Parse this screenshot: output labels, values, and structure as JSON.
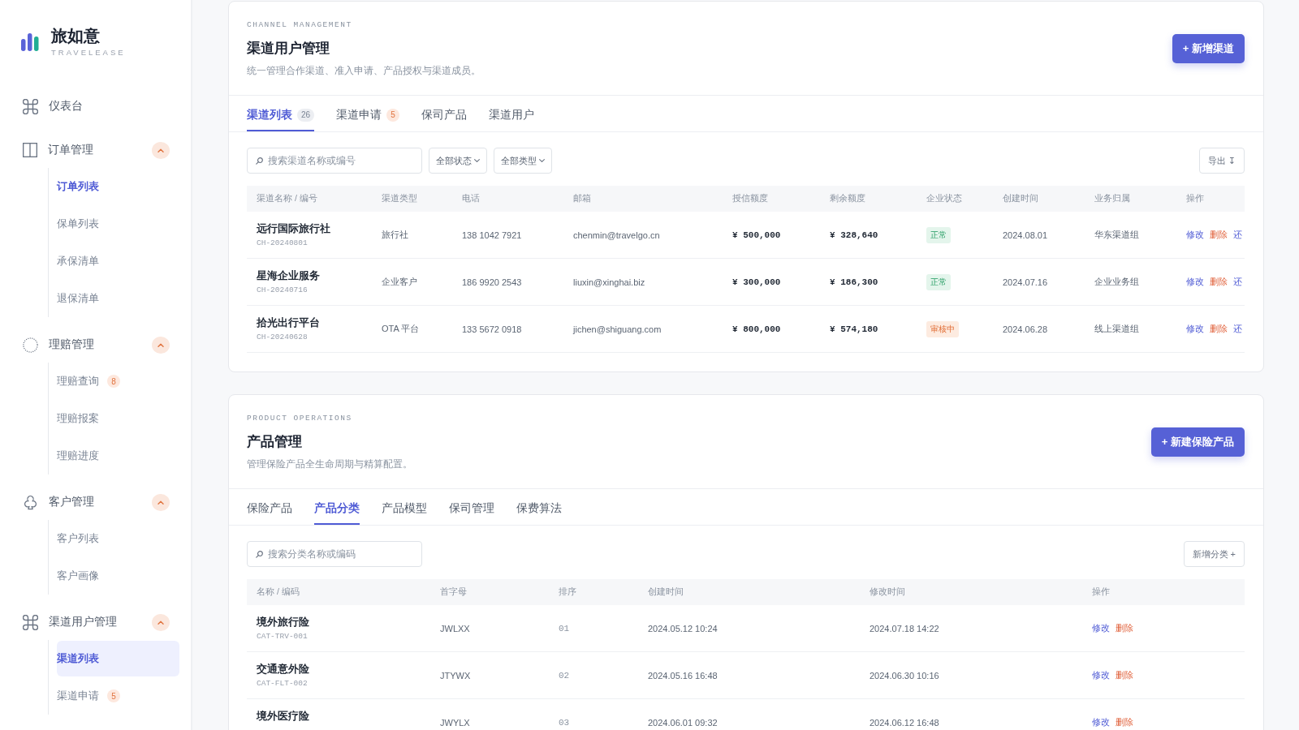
{
  "sidebar": {
    "logo": {
      "title": "旅如意",
      "subtitle": "TRAVELEASE"
    },
    "nav": [
      {
        "kind": "item",
        "label": "仪表台"
      },
      {
        "kind": "group",
        "label": "订单管理",
        "expanded": true,
        "children": [
          {
            "label": "订单列表",
            "selected": false,
            "emphasized": true
          },
          {
            "label": "保单列表",
            "selected": false,
            "emphasized": false
          },
          {
            "label": "承保清单",
            "selected": false,
            "emphasized": false
          },
          {
            "label": "退保清单",
            "selected": false,
            "emphasized": false
          }
        ]
      },
      {
        "kind": "group",
        "label": "理赔管理",
        "expanded": true,
        "children": [
          {
            "label": "理赔查询",
            "selected": false,
            "emphasized": false,
            "badge": {
              "text": "8",
              "kind": "alert"
            }
          },
          {
            "label": "理赔报案",
            "selected": false,
            "emphasized": false
          },
          {
            "label": "理赔进度",
            "selected": false,
            "emphasized": false
          }
        ]
      },
      {
        "kind": "group",
        "label": "客户管理",
        "expanded": true,
        "children": [
          {
            "label": "客户列表",
            "selected": false,
            "emphasized": false
          },
          {
            "label": "客户画像",
            "selected": false,
            "emphasized": false
          }
        ]
      },
      {
        "kind": "group",
        "label": "渠道用户管理",
        "expanded": true,
        "children": [
          {
            "label": "渠道列表",
            "selected": true,
            "emphasized": true
          },
          {
            "label": "渠道申请",
            "selected": false,
            "emphasized": false,
            "badge": {
              "text": "5",
              "kind": "alert"
            }
          }
        ]
      }
    ]
  },
  "sections": [
    {
      "eyebrow": "CHANNEL MANAGEMENT",
      "title": "渠道用户管理",
      "description": "统一管理合作渠道、准入申请、产品授权与渠道成员。",
      "primary_button": "+ 新增渠道",
      "tabs": [
        {
          "label": "渠道列表",
          "selected": true,
          "badge": {
            "text": "26",
            "kind": "neutral"
          }
        },
        {
          "label": "渠道申请",
          "selected": false,
          "badge": {
            "text": "5",
            "kind": "alert"
          }
        },
        {
          "label": "保司产品",
          "selected": false
        },
        {
          "label": "渠道用户",
          "selected": false
        }
      ],
      "search": {
        "placeholder": "搜索渠道名称或编号"
      },
      "filters": [
        "全部状态",
        "全部类型"
      ],
      "secondary_button": "导出 ↧",
      "table": {
        "columns": [
          "渠道名称 / 编号",
          "渠道类型",
          "电话",
          "邮箱",
          "授信额度",
          "剩余额度",
          "企业状态",
          "创建时间",
          "业务归属",
          "操作"
        ],
        "rows": [
          [
            {
              "kind": "title",
              "text": "远行国际旅行社",
              "code": "CH-20240801"
            },
            {
              "kind": "text",
              "text": "旅行社"
            },
            {
              "kind": "text",
              "text": "138 1042 7921"
            },
            {
              "kind": "text",
              "text": "chenmin@travelgo.cn"
            },
            {
              "kind": "amount",
              "text": "¥ 500,000"
            },
            {
              "kind": "amount",
              "text": "¥ 328,640"
            },
            {
              "kind": "status",
              "tag": {
                "text": "正常",
                "kind": "ok"
              }
            },
            {
              "kind": "text",
              "text": "2024.08.01"
            },
            {
              "kind": "text",
              "text": "华东渠道组"
            },
            {
              "kind": "actions",
              "actions": [
                {
                  "label": "修改",
                  "kind": "edit"
                },
                {
                  "label": "删除",
                  "kind": "delete"
                },
                {
                  "label": "还",
                  "kind": "more"
                }
              ]
            }
          ],
          [
            {
              "kind": "title",
              "text": "星海企业服务",
              "code": "CH-20240716"
            },
            {
              "kind": "text",
              "text": "企业客户"
            },
            {
              "kind": "text",
              "text": "186 9920 2543"
            },
            {
              "kind": "text",
              "text": "liuxin@xinghai.biz"
            },
            {
              "kind": "amount",
              "text": "¥ 300,000"
            },
            {
              "kind": "amount",
              "text": "¥ 186,300"
            },
            {
              "kind": "status",
              "tag": {
                "text": "正常",
                "kind": "ok"
              }
            },
            {
              "kind": "text",
              "text": "2024.07.16"
            },
            {
              "kind": "text",
              "text": "企业业务组"
            },
            {
              "kind": "actions",
              "actions": [
                {
                  "label": "修改",
                  "kind": "edit"
                },
                {
                  "label": "删除",
                  "kind": "delete"
                },
                {
                  "label": "还",
                  "kind": "more"
                }
              ]
            }
          ],
          [
            {
              "kind": "title",
              "text": "拾光出行平台",
              "code": "CH-20240628"
            },
            {
              "kind": "text",
              "text": "OTA 平台"
            },
            {
              "kind": "text",
              "text": "133 5672 0918"
            },
            {
              "kind": "text",
              "text": "jichen@shiguang.com"
            },
            {
              "kind": "amount",
              "text": "¥ 800,000"
            },
            {
              "kind": "amount",
              "text": "¥ 574,180"
            },
            {
              "kind": "status",
              "tag": {
                "text": "审核中",
                "kind": "pending"
              }
            },
            {
              "kind": "text",
              "text": "2024.06.28"
            },
            {
              "kind": "text",
              "text": "线上渠道组"
            },
            {
              "kind": "actions",
              "actions": [
                {
                  "label": "修改",
                  "kind": "edit"
                },
                {
                  "label": "删除",
                  "kind": "delete"
                },
                {
                  "label": "还",
                  "kind": "more"
                }
              ]
            }
          ]
        ]
      }
    },
    {
      "eyebrow": "PRODUCT OPERATIONS",
      "title": "产品管理",
      "description": "管理保险产品全生命周期与精算配置。",
      "primary_button": "+ 新建保险产品",
      "tabs": [
        {
          "label": "保险产品",
          "selected": false
        },
        {
          "label": "产品分类",
          "selected": true
        },
        {
          "label": "产品模型",
          "selected": false
        },
        {
          "label": "保司管理",
          "selected": false
        },
        {
          "label": "保费算法",
          "selected": false
        }
      ],
      "search": {
        "placeholder": "搜索分类名称或编码"
      },
      "secondary_button": "新增分类 +",
      "table": {
        "columns": [
          "名称 / 编码",
          "首字母",
          "排序",
          "创建时间",
          "修改时间",
          "操作"
        ],
        "rows": [
          [
            {
              "kind": "title",
              "text": "境外旅行险",
              "code": "CAT-TRV-001"
            },
            {
              "kind": "text",
              "text": "JWLXX"
            },
            {
              "kind": "index",
              "text": "01"
            },
            {
              "kind": "text",
              "text": "2024.05.12 10:24"
            },
            {
              "kind": "text",
              "text": "2024.07.18 14:22"
            },
            {
              "kind": "actions",
              "actions": [
                {
                  "label": "修改",
                  "kind": "edit"
                },
                {
                  "label": "删除",
                  "kind": "delete"
                }
              ]
            }
          ],
          [
            {
              "kind": "title",
              "text": "交通意外险",
              "code": "CAT-FLT-002"
            },
            {
              "kind": "text",
              "text": "JTYWX"
            },
            {
              "kind": "index",
              "text": "02"
            },
            {
              "kind": "text",
              "text": "2024.05.16 16:48"
            },
            {
              "kind": "text",
              "text": "2024.06.30 10:16"
            },
            {
              "kind": "actions",
              "actions": [
                {
                  "label": "修改",
                  "kind": "edit"
                },
                {
                  "label": "删除",
                  "kind": "delete"
                }
              ]
            }
          ],
          [
            {
              "kind": "title",
              "text": "境外医疗险"
            },
            {
              "kind": "text",
              "text": "JWYLX"
            },
            {
              "kind": "index",
              "text": "03"
            },
            {
              "kind": "text",
              "text": "2024.06.01 09:32"
            },
            {
              "kind": "text",
              "text": "2024.06.12 16:48"
            },
            {
              "kind": "actions",
              "actions": [
                {
                  "label": "修改",
                  "kind": "edit"
                },
                {
                  "label": "删除",
                  "kind": "delete"
                }
              ]
            }
          ]
        ]
      }
    }
  ]
}
